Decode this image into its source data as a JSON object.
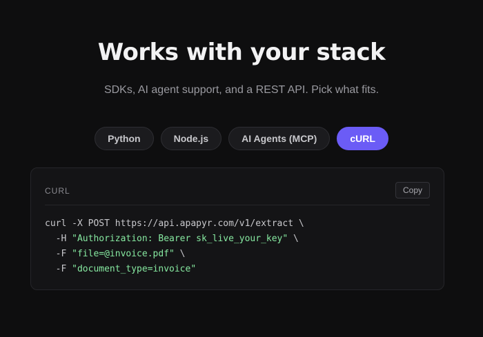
{
  "header": {
    "title": "Works with your stack",
    "subtitle": "SDKs, AI agent support, and a REST API. Pick what fits."
  },
  "tabs": [
    {
      "label": "Python",
      "active": false
    },
    {
      "label": "Node.js",
      "active": false
    },
    {
      "label": "AI Agents (MCP)",
      "active": false
    },
    {
      "label": "cURL",
      "active": true
    }
  ],
  "code_card": {
    "language_label": "CURL",
    "copy_label": "Copy",
    "lines": [
      {
        "indent": "",
        "flag": "",
        "cmd": "curl -X POST https://api.apapyr.com/v1/extract \\",
        "string": "",
        "tail": ""
      },
      {
        "indent": "  ",
        "flag": "-H ",
        "cmd": "",
        "string": "\"Authorization: Bearer sk_live_your_key\"",
        "tail": " \\"
      },
      {
        "indent": "  ",
        "flag": "-F ",
        "cmd": "",
        "string": "\"file=@invoice.pdf\"",
        "tail": " \\"
      },
      {
        "indent": "  ",
        "flag": "-F ",
        "cmd": "",
        "string": "\"document_type=invoice\"",
        "tail": ""
      }
    ]
  },
  "colors": {
    "background": "#0e0e0f",
    "accent": "#6b5cf6",
    "string": "#86e8a0"
  }
}
